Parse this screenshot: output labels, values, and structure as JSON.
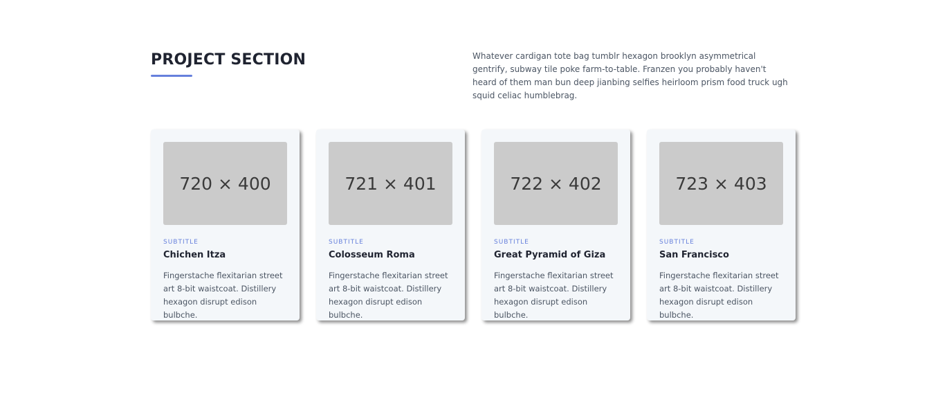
{
  "section": {
    "title": "PROJECT SECTION",
    "description": "Whatever cardigan tote bag tumblr hexagon brooklyn asymmetrical gentrify, subway tile poke farm-to-table. Franzen you probably haven't heard of them man bun deep jianbing selfies heirloom prism food truck ugh squid celiac humblebrag."
  },
  "colors": {
    "accent": "#6680dc",
    "card_bg": "#f4f7fa",
    "placeholder_bg": "#cbcbcb"
  },
  "cards": [
    {
      "image_label": "720 × 400",
      "subtitle": "SUBTITLE",
      "title": "Chichen Itza",
      "body": "Fingerstache flexitarian street art 8-bit waistcoat. Distillery hexagon disrupt edison bulbche."
    },
    {
      "image_label": "721 × 401",
      "subtitle": "SUBTITLE",
      "title": "Colosseum Roma",
      "body": "Fingerstache flexitarian street art 8-bit waistcoat. Distillery hexagon disrupt edison bulbche."
    },
    {
      "image_label": "722 × 402",
      "subtitle": "SUBTITLE",
      "title": "Great Pyramid of Giza",
      "body": "Fingerstache flexitarian street art 8-bit waistcoat. Distillery hexagon disrupt edison bulbche."
    },
    {
      "image_label": "723 × 403",
      "subtitle": "SUBTITLE",
      "title": "San Francisco",
      "body": "Fingerstache flexitarian street art 8-bit waistcoat. Distillery hexagon disrupt edison bulbche."
    }
  ]
}
